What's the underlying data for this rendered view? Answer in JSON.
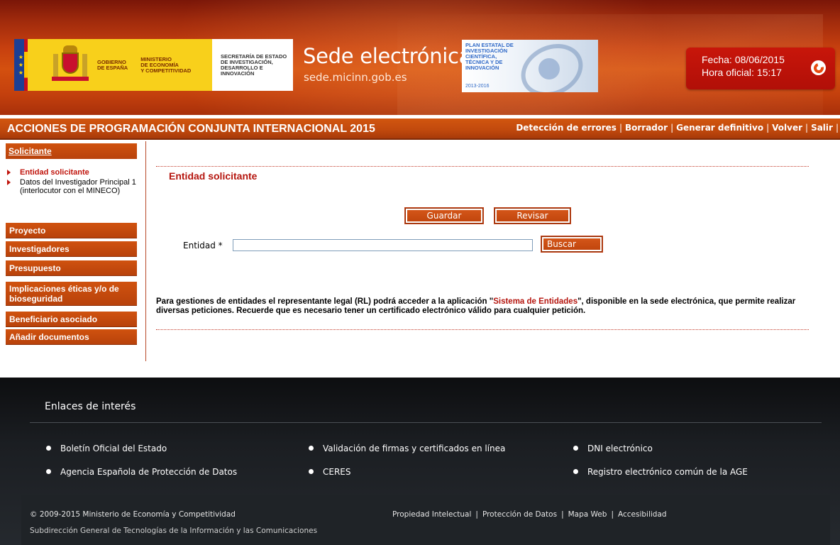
{
  "header": {
    "gov_line1": "GOBIERNO",
    "gov_line2": "DE ESPAÑA",
    "ministry_line1": "MINISTERIO",
    "ministry_line2": "DE ECONOMÍA",
    "ministry_line3": "Y COMPETITIVIDAD",
    "secretaria_line1": "SECRETARÍA DE ESTADO",
    "secretaria_line2": "DE INVESTIGACIÓN,",
    "secretaria_line3": "DESARROLLO E",
    "secretaria_line4": "INNOVACIÓN",
    "site_title": "Sede electrónica",
    "site_url": "sede.micinn.gob.es",
    "plan_line1": "PLAN ESTATAL DE",
    "plan_line2": "INVESTIGACIÓN",
    "plan_line3": "CIENTÍFICA,",
    "plan_line4": "TÉCNICA Y DE",
    "plan_line5": "INNOVACIÓN",
    "plan_years": "2013-2016",
    "fecha_label": "Fecha:",
    "fecha_value": "08/06/2015",
    "hora_label": "Hora oficial:",
    "hora_value": "15:17",
    "refresh_icon": "refresh-icon",
    "accent_color": "#c7400f"
  },
  "titlebar": {
    "title": "ACCIONES DE PROGRAMACIÓN CONJUNTA INTERNACIONAL 2015",
    "actions": [
      "Detección de errores",
      "Borrador",
      "Generar definitivo",
      "Volver",
      "Salir"
    ]
  },
  "sidebar": {
    "solicitante": "Solicitante",
    "sub_items": [
      "Entidad solicitante",
      "Datos del Investigador Principal 1 (interlocutor con el MINECO)"
    ],
    "sections": [
      "Proyecto",
      "Investigadores",
      "Presupuesto",
      "Implicaciones éticas y/o de bioseguridad",
      "Beneficiario asociado",
      "Añadir documentos"
    ]
  },
  "main": {
    "section_title": "Entidad solicitante",
    "guardar_label": "Guardar",
    "revisar_label": "Revisar",
    "entidad_label": "Entidad *",
    "entidad_value": "",
    "buscar_label": "Buscar",
    "info_part1": "Para gestiones de entidades el representante legal (RL) podrá acceder a la aplicación \"",
    "info_link": "Sistema de Entidades",
    "info_part2": "\", disponible en la sede electrónica, que permite realizar diversas peticiones. Recuerde que es necesario tener un certificado electrónico válido para cualquier petición."
  },
  "footer": {
    "heading": "Enlaces de interés",
    "links": [
      "Boletín Oficial del Estado",
      "Validación de firmas y certificados en línea",
      "DNI electrónico",
      "Agencia Española de Protección de Datos",
      "CERES",
      "Registro electrónico común de la AGE"
    ],
    "copyright": "© 2009-2015 Ministerio de Economía y Competitividad",
    "subdireccion": "Subdirección General de Tecnologías de la Información y las Comunicaciones",
    "legal_links": [
      "Propiedad Intelectual",
      "Protección de Datos",
      "Mapa Web",
      "Accesibilidad"
    ]
  }
}
